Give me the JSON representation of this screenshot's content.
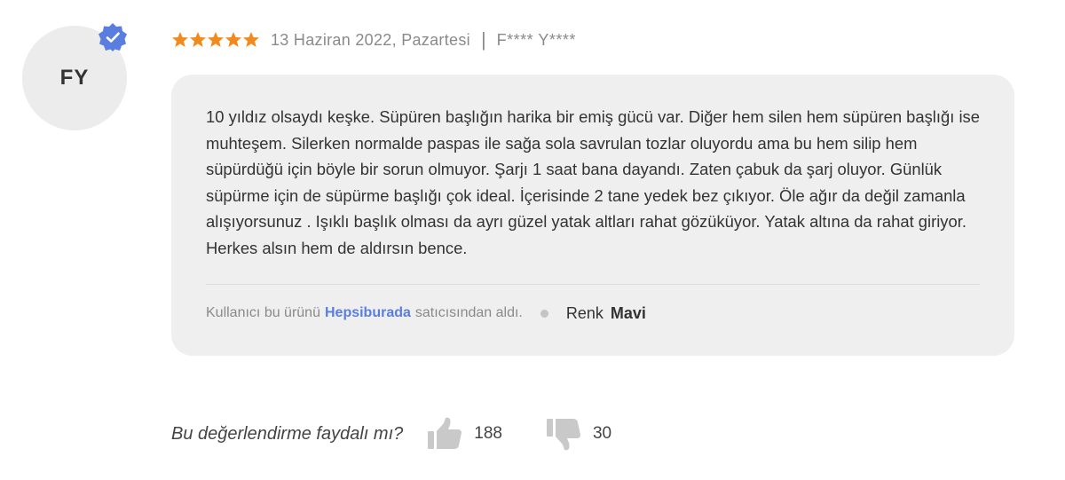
{
  "reviewer": {
    "initials": "FY",
    "name": "F**** Y****",
    "verified_icon": "verified-badge-icon",
    "verified_color": "#5a7ee0"
  },
  "rating": {
    "stars": 5,
    "max": 5,
    "star_color": "#f28b1e",
    "icon": "star-icon"
  },
  "date": "13 Haziran 2022, Pazartesi",
  "separator": "|",
  "review": {
    "text": "10 yıldız olsaydı keşke. Süpüren başlığın harika bir emiş gücü var. Diğer hem silen hem süpüren başlığı ise muhteşem. Silerken normalde paspas ile sağa sola savrulan tozlar oluyordu ama bu hem silip hem süpürdüğü için böyle bir sorun olmuyor. Şarjı 1 saat bana dayandı. Zaten çabuk da şarj oluyor. Günlük süpürme için de süpürme başlığı çok ideal. İçerisinde 2 tane yedek bez çıkıyor. Öle ağır da değil zamanla alışıyorsunuz . Işıklı başlık olması da ayrı güzel yatak altları rahat gözüküyor. Yatak altına da rahat giriyor. Herkes alsın hem de aldırsın bence.",
    "card_color": "#efefef"
  },
  "purchase": {
    "prefix": "Kullanıcı bu ürünü",
    "seller": "Hepsiburada",
    "suffix": "satıcısından aldı.",
    "seller_color": "#5a7ee0"
  },
  "variant": {
    "label": "Renk",
    "value": "Mavi"
  },
  "helpful": {
    "question": "Bu değerlendirme faydalı mı?",
    "up_count": "188",
    "down_count": "30",
    "up_icon": "thumbs-up-icon",
    "down_icon": "thumbs-down-icon"
  }
}
